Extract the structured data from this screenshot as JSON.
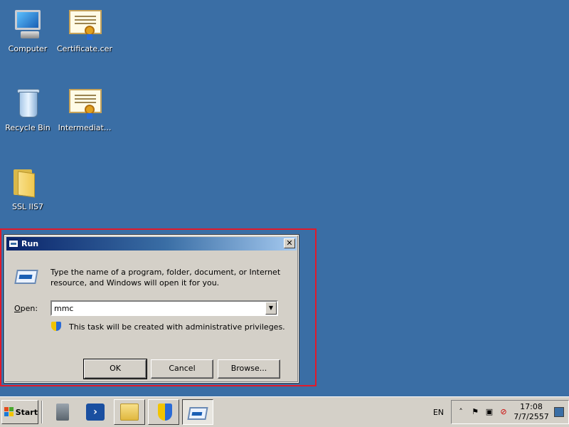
{
  "desktop": {
    "icons": [
      {
        "label": "Computer",
        "icon": "computer-icon"
      },
      {
        "label": "Certificate.cer",
        "icon": "certificate-icon"
      },
      {
        "label": "Recycle Bin",
        "icon": "recycle-bin-icon"
      },
      {
        "label": "Intermediat...",
        "icon": "certificate-icon"
      },
      {
        "label": "SSL IIS7",
        "icon": "folder-icon"
      }
    ]
  },
  "dialog": {
    "title": "Run",
    "instruction": "Type the name of a program, folder, document, or Internet resource, and Windows will open it for you.",
    "open_label_prefix": "O",
    "open_label_rest": "pen:",
    "open_value": "mmc",
    "admin_note": "This task will be created with administrative privileges.",
    "buttons": {
      "ok": "OK",
      "cancel": "Cancel",
      "browse": "Browse..."
    },
    "close_glyph": "✕"
  },
  "taskbar": {
    "start_label": "Start",
    "language": "EN",
    "clock_time": "17:08",
    "clock_date": "7/7/2557",
    "items": [
      "server-manager-icon",
      "powershell-icon",
      "explorer-icon",
      "security-icon",
      "run-icon"
    ],
    "powershell_glyph": "›"
  },
  "colors": {
    "desktop": "#3a6ea5",
    "highlight": "#e01a2b",
    "titlebar": "#0a246a"
  }
}
